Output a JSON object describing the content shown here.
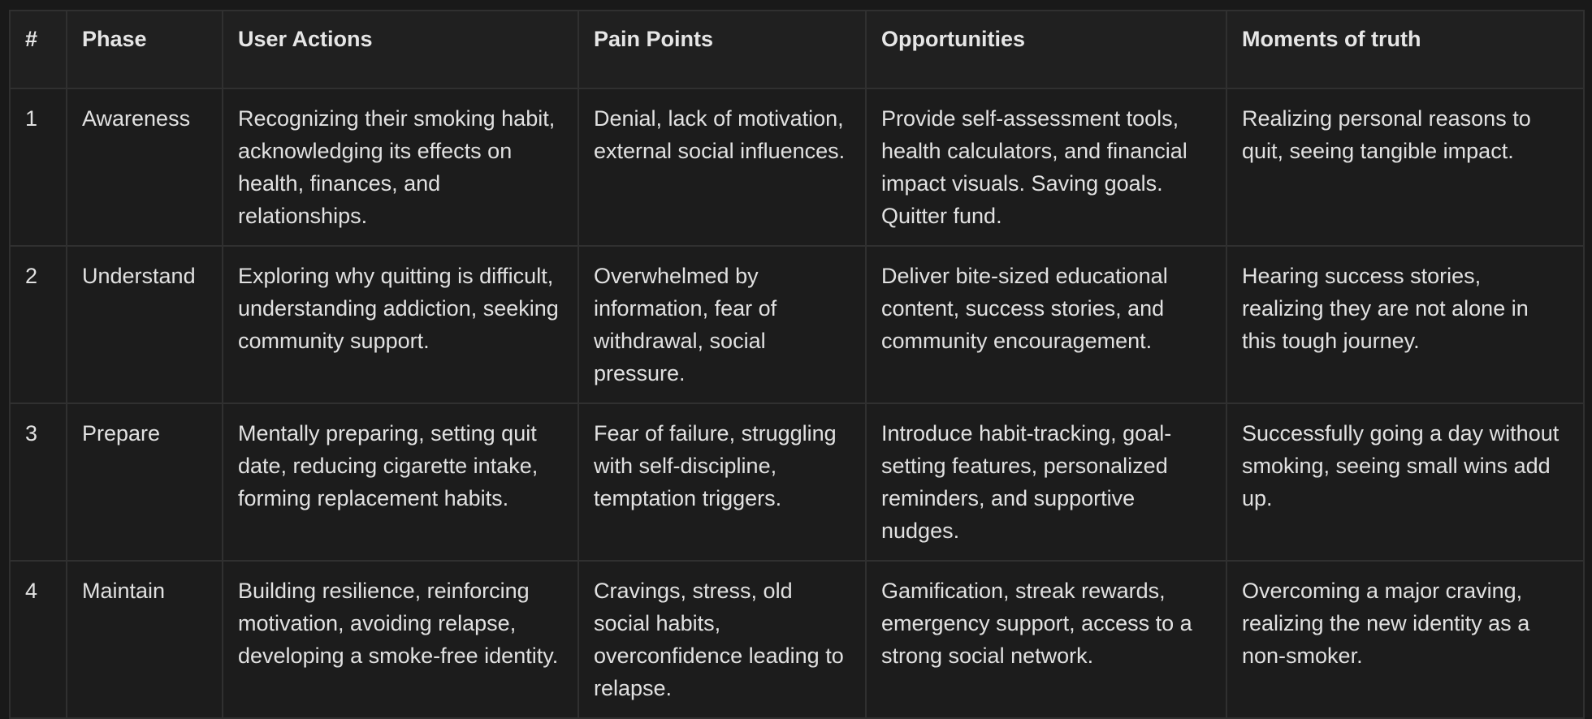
{
  "table": {
    "headers": [
      "#",
      "Phase",
      "User Actions",
      "Pain Points",
      "Opportunities",
      "Moments of truth"
    ],
    "rows": [
      {
        "num": "1",
        "phase": "Awareness",
        "user_actions": "Recognizing their smoking habit, acknowledging its effects on health, finances, and relationships.",
        "pain_points": "Denial, lack of motivation, external social influences.",
        "opportunities": "Provide self-assessment tools, health calculators, and financial impact visuals. Saving goals. Quitter fund.",
        "moments_of_truth": "Realizing personal reasons to quit, seeing tangible impact."
      },
      {
        "num": "2",
        "phase": "Understand",
        "user_actions": "Exploring why quitting is difficult, understanding addiction, seeking community support.",
        "pain_points": "Overwhelmed by information, fear of withdrawal, social pressure.",
        "opportunities": "Deliver bite-sized educational content, success stories, and community encouragement.",
        "moments_of_truth": "Hearing success stories, realizing they are not alone in this tough journey."
      },
      {
        "num": "3",
        "phase": "Prepare",
        "user_actions": "Mentally preparing, setting quit date, reducing cigarette intake, forming replacement habits.",
        "pain_points": "Fear of failure, struggling with self-discipline, temptation triggers.",
        "opportunities": "Introduce habit-tracking, goal-setting features, personalized reminders, and supportive nudges.",
        "moments_of_truth": "Successfully going a day without smoking, seeing small wins add up."
      },
      {
        "num": "4",
        "phase": "Maintain",
        "user_actions": "Building resilience, reinforcing motivation, avoiding relapse, developing a smoke-free identity.",
        "pain_points": "Cravings, stress, old social habits, overconfidence leading to relapse.",
        "opportunities": "Gamification, streak rewards, emergency support, access to a strong social network.",
        "moments_of_truth": "Overcoming a major craving, realizing the new identity as a non-smoker."
      }
    ]
  }
}
